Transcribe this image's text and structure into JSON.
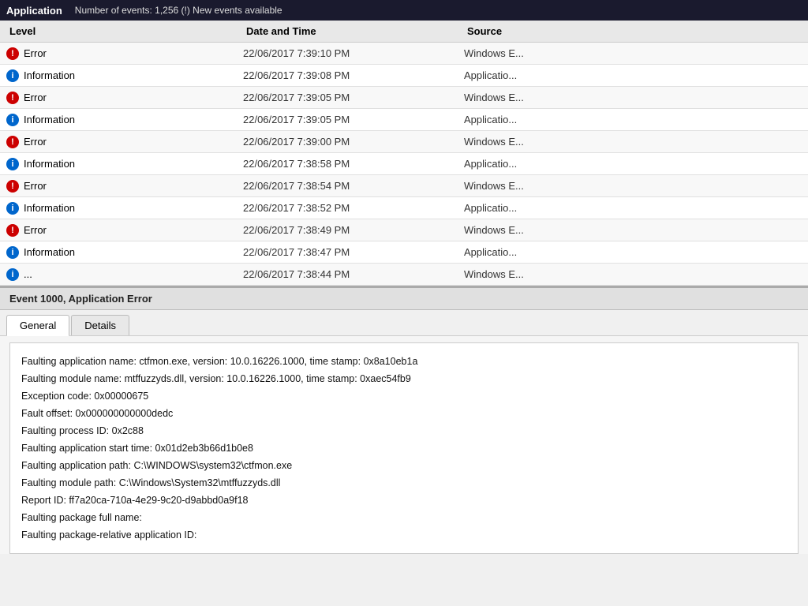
{
  "header": {
    "title": "Application",
    "events_label": "Number of events: 1,256 (!) New events available"
  },
  "table": {
    "columns": [
      "Level",
      "Date and Time",
      "Source"
    ],
    "rows": [
      {
        "level": "Error",
        "level_type": "error",
        "date": "22/06/2017 7:39:10 PM",
        "source": "Windows E..."
      },
      {
        "level": "Information",
        "level_type": "info",
        "date": "22/06/2017 7:39:08 PM",
        "source": "Applicatio..."
      },
      {
        "level": "Error",
        "level_type": "error",
        "date": "22/06/2017 7:39:05 PM",
        "source": "Windows E..."
      },
      {
        "level": "Information",
        "level_type": "info",
        "date": "22/06/2017 7:39:05 PM",
        "source": "Applicatio..."
      },
      {
        "level": "Error",
        "level_type": "error",
        "date": "22/06/2017 7:39:00 PM",
        "source": "Windows E..."
      },
      {
        "level": "Information",
        "level_type": "info",
        "date": "22/06/2017 7:38:58 PM",
        "source": "Applicatio..."
      },
      {
        "level": "Error",
        "level_type": "error",
        "date": "22/06/2017 7:38:54 PM",
        "source": "Windows E..."
      },
      {
        "level": "Information",
        "level_type": "info",
        "date": "22/06/2017 7:38:52 PM",
        "source": "Applicatio..."
      },
      {
        "level": "Error",
        "level_type": "error",
        "date": "22/06/2017 7:38:49 PM",
        "source": "Windows E..."
      },
      {
        "level": "Information",
        "level_type": "info",
        "date": "22/06/2017 7:38:47 PM",
        "source": "Applicatio..."
      },
      {
        "level": "...",
        "level_type": "info",
        "date": "22/06/2017 7:38:44 PM",
        "source": "Windows E..."
      }
    ]
  },
  "detail": {
    "event_title": "Event 1000, Application Error",
    "tabs": [
      "General",
      "Details"
    ],
    "active_tab": "General",
    "content_lines": [
      "Faulting application name: ctfmon.exe, version: 10.0.16226.1000, time stamp: 0x8a10eb1a",
      "Faulting module name: mtffuzzyds.dll, version: 10.0.16226.1000, time stamp: 0xaec54fb9",
      "Exception code: 0x00000675",
      "Fault offset: 0x000000000000dedc",
      "Faulting process ID: 0x2c88",
      "Faulting application start time: 0x01d2eb3b66d1b0e8",
      "Faulting application path: C:\\WINDOWS\\system32\\ctfmon.exe",
      "Faulting module path: C:\\Windows\\System32\\mtffuzzyds.dll",
      "Report ID: ff7a20ca-710a-4e29-9c20-d9abbd0a9f18",
      "Faulting package full name:",
      "Faulting package-relative application ID:"
    ]
  }
}
